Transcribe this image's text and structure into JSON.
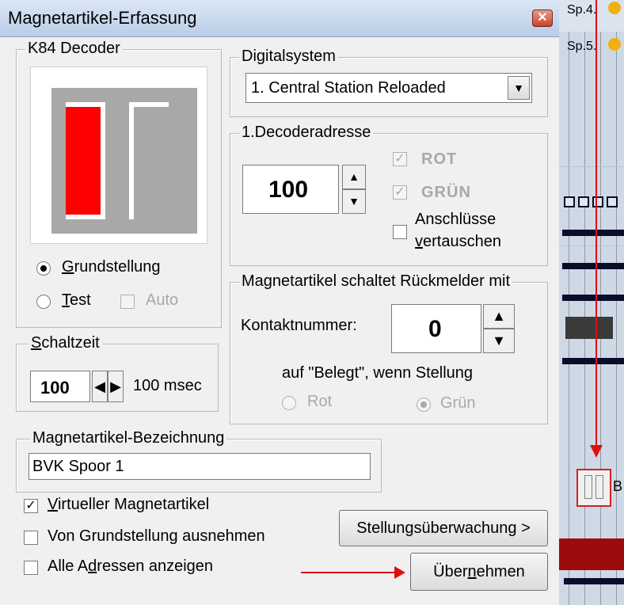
{
  "window": {
    "title": "Magnetartikel-Erfassung"
  },
  "decoder_group": {
    "title": "K84 Decoder",
    "radio_grundstellung": {
      "label_u": "G",
      "label_rest": "rundstellung",
      "checked": true
    },
    "radio_test": {
      "label_u": "T",
      "label_rest": "est",
      "checked": false
    },
    "check_auto": {
      "label": "Auto",
      "checked": false,
      "disabled": true
    }
  },
  "schaltzeit": {
    "title_u": "S",
    "title_rest": "chaltzeit",
    "value": "100",
    "display": "100 msec"
  },
  "digitalsystem": {
    "title": "Digitalsystem",
    "selected": "1. Central Station Reloaded"
  },
  "decoderadresse": {
    "title": "1.Decoderadresse",
    "value": "100",
    "check_rot": {
      "label": "ROT",
      "checked": true,
      "disabled": true
    },
    "check_gruen": {
      "label": "GRÜN",
      "checked": true,
      "disabled": true
    },
    "check_swap": {
      "label_line1": "Anschlüsse",
      "label_line2_u": "v",
      "label_line2_rest": "ertauschen",
      "checked": false
    }
  },
  "rueckmelder": {
    "title": "Magnetartikel schaltet Rückmelder mit",
    "kontakt_label": "Kontaktnummer:",
    "kontakt_value": "0",
    "condition": "auf \"Belegt\", wenn Stellung",
    "radio_rot": {
      "label": "Rot",
      "checked": false,
      "disabled": true
    },
    "radio_gruen": {
      "label": "Grün",
      "checked": true,
      "disabled": true
    }
  },
  "bezeichnung": {
    "title": "Magnetartikel-Bezeichnung",
    "value": "BVK Spoor 1"
  },
  "options": {
    "virtuell": {
      "label_u": "V",
      "label_rest": "irtueller Magnetartikel",
      "checked": true
    },
    "ausnehmen": {
      "label": "Von Grundstellung ausnehmen",
      "checked": false
    },
    "alle": {
      "label_pre": "Alle A",
      "label_u": "d",
      "label_rest": "ressen anzeigen",
      "checked": false
    }
  },
  "buttons": {
    "stellung": "Stellungsüberwachung >",
    "uebernehmen_pre": "Über",
    "uebernehmen_u": "n",
    "uebernehmen_rest": "ehmen"
  },
  "background": {
    "label_sp4": "Sp.4.",
    "label_sp5": "Sp.5.",
    "label_b": "B"
  },
  "colors": {
    "accent_red": "#e01010",
    "decoder_red": "#ff0000"
  }
}
